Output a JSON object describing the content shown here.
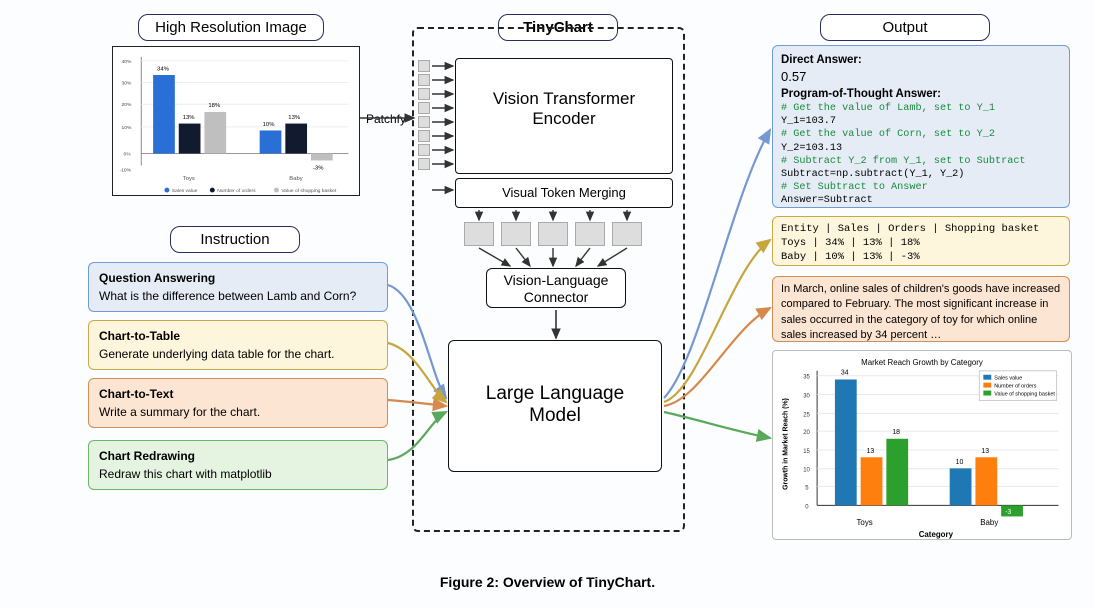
{
  "labels": {
    "high_res": "High Resolution Image",
    "tinychart": "TinyChart",
    "output": "Output",
    "instruction": "Instruction",
    "patchfy": "Patchfy"
  },
  "center": {
    "vit": "Vision Transformer\nEncoder",
    "vtm": "Visual Token Merging",
    "vlc": "Vision-Language\nConnector",
    "llm": "Large Language\nModel"
  },
  "instructions": {
    "qa_title": "Question Answering",
    "qa_body": "What is the difference between Lamb and Corn?",
    "ctbl_title": "Chart-to-Table",
    "ctbl_body": "Generate underlying data table for the chart.",
    "ctxt_title": "Chart-to-Text",
    "ctxt_body": "Write a summary for the chart.",
    "crdr_title": "Chart Redrawing",
    "crdr_body": "Redraw this chart with matplotlib"
  },
  "output_direct": {
    "da_label": "Direct Answer:",
    "da_value": "0.57",
    "pot_label": "Program-of-Thought Answer:",
    "c1": "# Get the value of Lamb, set to Y_1",
    "l1": "Y_1=103.7",
    "c2": "# Get the value of Corn, set to Y_2",
    "l2": "Y_2=103.13",
    "c3": "# Subtract Y_2 from Y_1, set to Subtract",
    "l3": "Subtract=np.subtract(Y_1, Y_2)",
    "c4": "# Set Subtract to Answer",
    "l4": "Answer=Subtract"
  },
  "output_table": "Entity | Sales | Orders | Shopping basket\nToys | 34% | 13% | 18%\nBaby | 10% | 13% | -3%",
  "output_text": "In March, online sales of children's goods have increased compared to February. The most significant increase in sales occurred in the category of toy for which online sales increased by 34 percent …",
  "figure_caption": "Figure 2: Overview of TinyChart.",
  "input_chart_legend": {
    "s1": "Sales value",
    "s2": "Number of orders",
    "s3": "Value of shopping basket"
  },
  "output_chart": {
    "title": "Market Reach Growth by Category",
    "ylabel": "Growth in Market Reach (%)",
    "xlabel": "Category",
    "legend1": "Sales value",
    "legend2": "Number of orders",
    "legend3": "Value of shopping basket"
  },
  "chart_data": [
    {
      "type": "bar",
      "role": "input-chart",
      "title": "",
      "xlabel": "",
      "ylabel": "",
      "ylim": [
        -10,
        40
      ],
      "categories": [
        "Toys",
        "Baby"
      ],
      "series": [
        {
          "name": "Sales value",
          "values": [
            34,
            10
          ]
        },
        {
          "name": "Number of orders",
          "values": [
            13,
            13
          ]
        },
        {
          "name": "Value of shopping basket",
          "values": [
            18,
            -3
          ]
        }
      ]
    },
    {
      "type": "bar",
      "role": "output-chart",
      "title": "Market Reach Growth by Category",
      "xlabel": "Category",
      "ylabel": "Growth in Market Reach (%)",
      "ylim": [
        0,
        35
      ],
      "categories": [
        "Toys",
        "Baby"
      ],
      "series": [
        {
          "name": "Sales value",
          "values": [
            34,
            10
          ]
        },
        {
          "name": "Number of orders",
          "values": [
            13,
            13
          ]
        },
        {
          "name": "Value of shopping basket",
          "values": [
            18,
            -3
          ]
        }
      ]
    }
  ]
}
